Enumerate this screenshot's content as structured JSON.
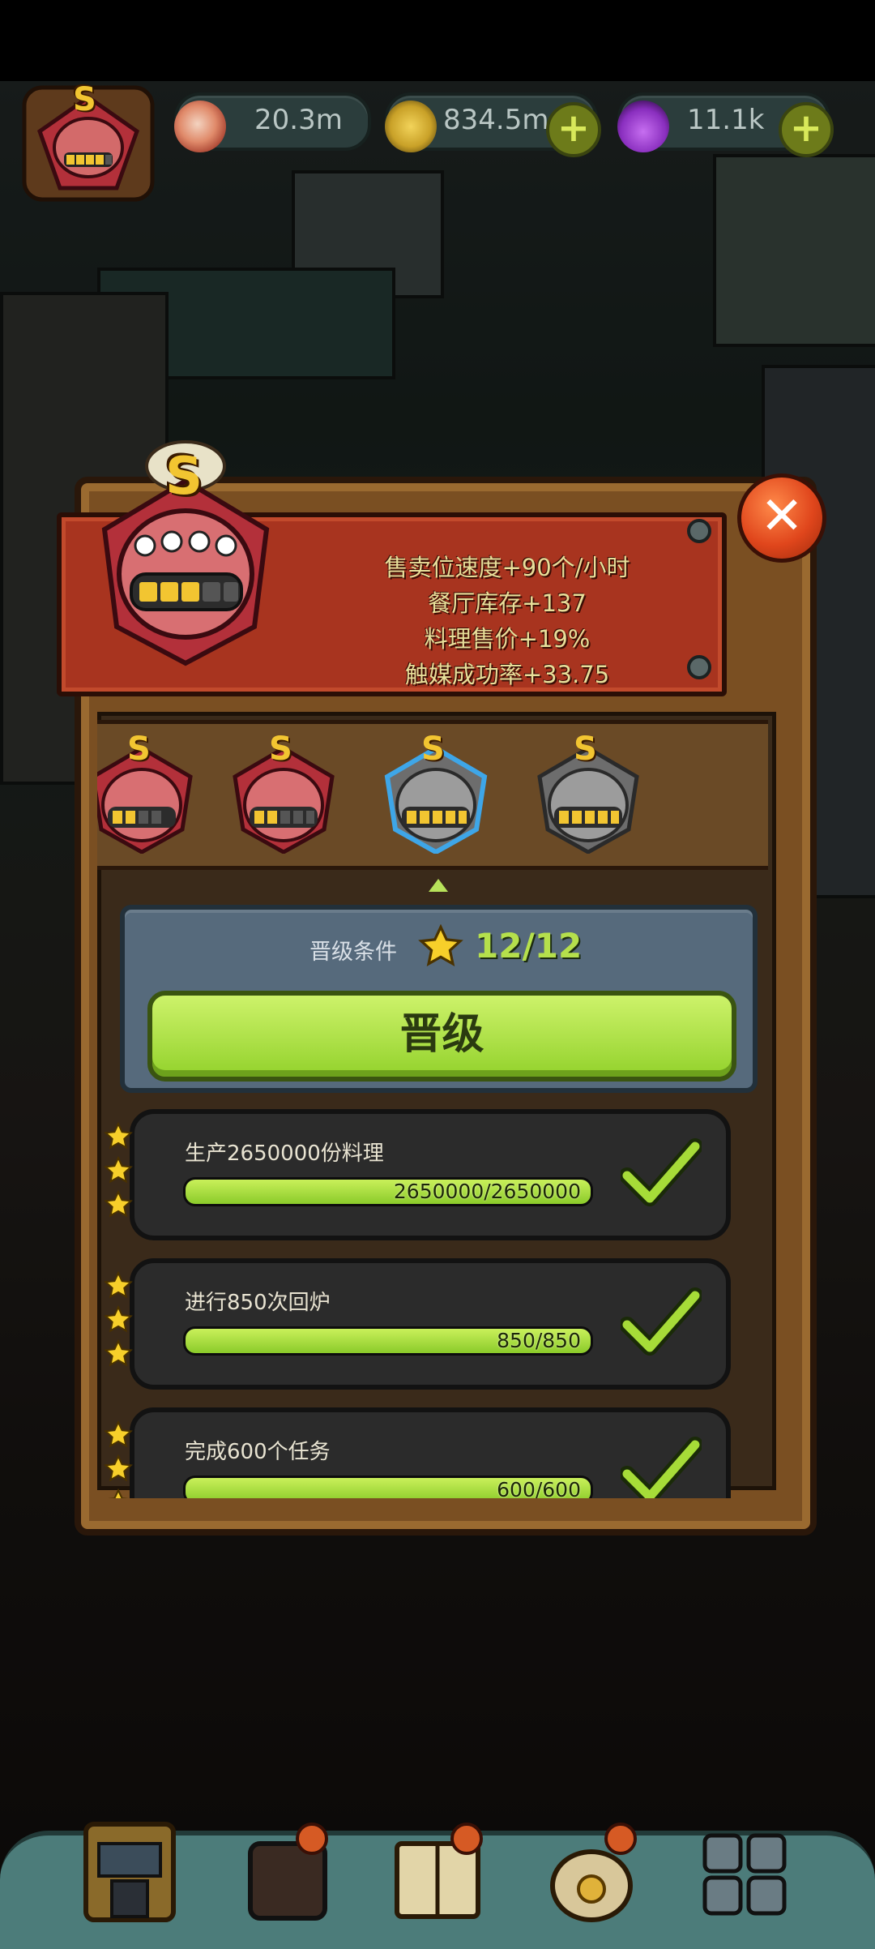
{
  "resources": {
    "eyeball": {
      "value": "20.3m",
      "icon": "eyeball-icon"
    },
    "coin": {
      "value": "834.5m",
      "icon": "coin-icon"
    },
    "potion": {
      "value": "11.1k",
      "icon": "potion-icon"
    }
  },
  "player_rank": "S",
  "panel": {
    "bonuses": [
      "售卖位速度+90个/小时",
      "餐厅库存+137",
      "料理售价+19%",
      "触媒成功率+33.75"
    ],
    "badge_letter": "S",
    "badge_pips_filled": 3,
    "badge_pips_total": 5,
    "tiers": [
      {
        "letter": "S",
        "color": "red",
        "pips": 4
      },
      {
        "letter": "S",
        "color": "red",
        "pips": 5
      },
      {
        "letter": "S",
        "color": "gray",
        "pips": 5,
        "selected": true
      },
      {
        "letter": "S",
        "color": "gray",
        "pips": 5
      }
    ],
    "condition_label": "晋级条件",
    "condition_value": "12/12",
    "promote_label": "晋级",
    "tasks": [
      {
        "title": "生产2650000份料理",
        "progress_text": "2650000/2650000",
        "progress": 1.0,
        "stars": 3,
        "done": true
      },
      {
        "title": "进行850次回炉",
        "progress_text": "850/850",
        "progress": 1.0,
        "stars": 3,
        "done": true
      },
      {
        "title": "完成600个任务",
        "progress_text": "600/600",
        "progress": 1.0,
        "stars": 3,
        "done": true
      }
    ]
  },
  "colors": {
    "accent_green": "#b5e04c",
    "banner_red": "#a8341f",
    "wood": "#7a4f22"
  }
}
